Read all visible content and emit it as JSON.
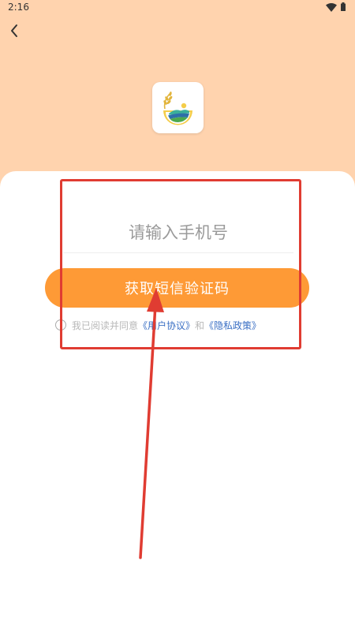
{
  "status_bar": {
    "time": "2:16"
  },
  "header": {
    "back_icon": "chevron-left-icon",
    "logo_icon": "wheat-field-logo-icon"
  },
  "form": {
    "phone_placeholder": "请输入手机号",
    "phone_value": "",
    "submit_label": "获取短信验证码",
    "agreement": {
      "checked": false,
      "prefix": "我已阅读并同意",
      "user_agreement": "《用户协议》",
      "connector": "和",
      "privacy_policy": "《隐私政策》"
    }
  },
  "colors": {
    "header_background": "#FFD3AE",
    "primary_button": "#FE9A36",
    "link": "#3A6FC4",
    "annotation": "#E03C32"
  }
}
